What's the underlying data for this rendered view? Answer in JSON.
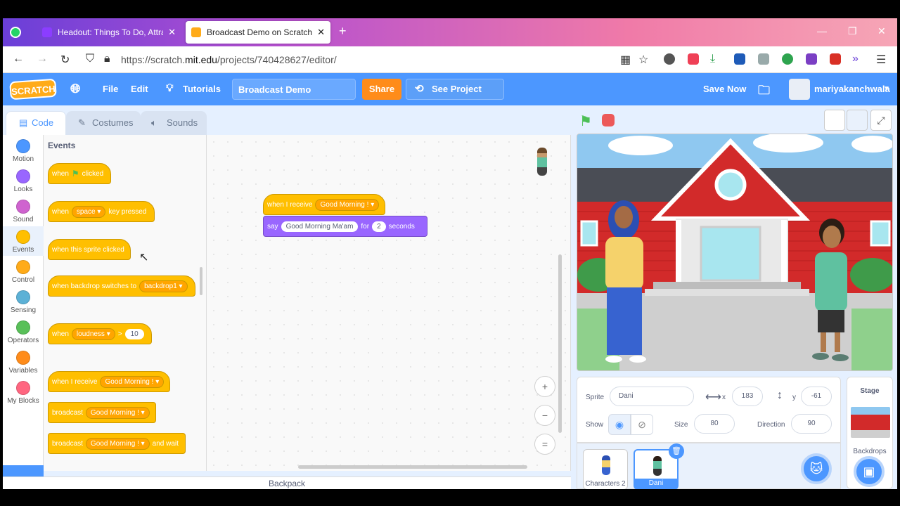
{
  "browser": {
    "tabs": [
      {
        "label": "Headout: Things To Do, Attracti",
        "active": false
      },
      {
        "label": "Broadcast Demo on Scratch",
        "active": true
      }
    ],
    "new_tab": "+",
    "url_prefix": "https://scratch.",
    "url_domain": "mit.edu",
    "url_path": "/projects/740428627/editor/"
  },
  "menubar": {
    "logo": "SCRATCH",
    "file": "File",
    "edit": "Edit",
    "tutorials": "Tutorials",
    "project_title": "Broadcast Demo",
    "share": "Share",
    "see_project": "See Project Page",
    "save_now": "Save Now",
    "username": "mariyakanchwala"
  },
  "editor_tabs": [
    "Code",
    "Costumes",
    "Sounds"
  ],
  "categories": [
    {
      "label": "Motion",
      "color": "#4c97ff"
    },
    {
      "label": "Looks",
      "color": "#9966ff"
    },
    {
      "label": "Sound",
      "color": "#cf63cf"
    },
    {
      "label": "Events",
      "color": "#ffbf00"
    },
    {
      "label": "Control",
      "color": "#ffab19"
    },
    {
      "label": "Sensing",
      "color": "#5cb1d6"
    },
    {
      "label": "Operators",
      "color": "#59c059"
    },
    {
      "label": "Variables",
      "color": "#ff8c1a"
    },
    {
      "label": "My Blocks",
      "color": "#ff6680"
    }
  ],
  "palette": {
    "title": "Events",
    "blocks": {
      "flag_pre": "when",
      "flag_post": "clicked",
      "key_pre": "when",
      "key_dd": "space",
      "key_post": "key pressed",
      "sprite_clicked": "when this sprite clicked",
      "backdrop_pre": "when backdrop switches to",
      "backdrop_dd": "backdrop1",
      "loud_pre": "when",
      "loud_dd": "loudness",
      "loud_op": ">",
      "loud_val": "10",
      "recv_pre": "when I receive",
      "recv_dd": "Good Morning !",
      "bc_pre": "broadcast",
      "bc_dd": "Good Morning !",
      "bcw_pre": "broadcast",
      "bcw_dd": "Good Morning !",
      "bcw_post": "and wait"
    }
  },
  "workspace": {
    "hat_pre": "when I receive",
    "hat_dd": "Good Morning !",
    "say": "say",
    "say_text": "Good Morning Ma'am",
    "for": "for",
    "secs_val": "2",
    "seconds": "seconds",
    "zoom_in": "+",
    "zoom_out": "−",
    "zoom_reset": "="
  },
  "backpack": "Backpack",
  "sprite_info": {
    "sprite_label": "Sprite",
    "sprite_name": "Dani",
    "x_label": "x",
    "x_val": "183",
    "y_label": "y",
    "y_val": "-61",
    "show_label": "Show",
    "size_label": "Size",
    "size_val": "80",
    "direction_label": "Direction",
    "direction_val": "90"
  },
  "sprites": [
    {
      "name": "Characters 2",
      "selected": false
    },
    {
      "name": "Dani",
      "selected": true
    }
  ],
  "stage_pane": {
    "title": "Stage",
    "backdrops": "Backdrops"
  }
}
